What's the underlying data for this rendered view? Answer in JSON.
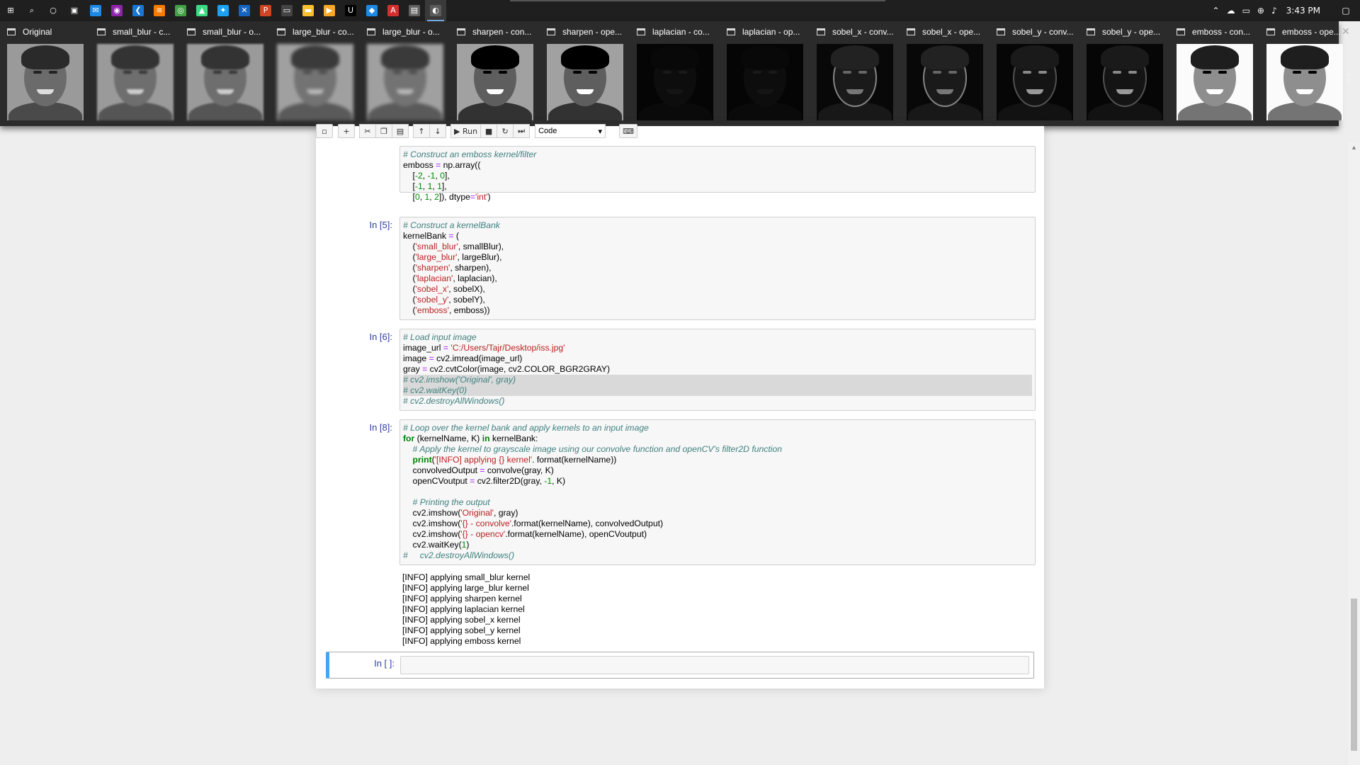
{
  "taskbar": {
    "icons": [
      {
        "name": "start-icon",
        "glyph": "⊞",
        "color": "#1f1f1f"
      },
      {
        "name": "search-icon",
        "glyph": "⌕",
        "color": "#1f1f1f"
      },
      {
        "name": "cortana-icon",
        "glyph": "○",
        "color": "#1f1f1f"
      },
      {
        "name": "store-icon",
        "glyph": "▣",
        "color": "#1f1f1f"
      },
      {
        "name": "mail-icon",
        "glyph": "✉",
        "color": "#1e88e5"
      },
      {
        "name": "media-icon",
        "glyph": "◉",
        "color": "#8e24aa"
      },
      {
        "name": "vscode-icon",
        "glyph": "❮",
        "color": "#1976d2"
      },
      {
        "name": "jupyter-icon",
        "glyph": "≋",
        "color": "#f57c00"
      },
      {
        "name": "chrome-icon",
        "glyph": "◎",
        "color": "#43a047"
      },
      {
        "name": "android-studio-icon",
        "glyph": "▲",
        "color": "#3ddc84"
      },
      {
        "name": "twitter-icon",
        "glyph": "✦",
        "color": "#1da1f2"
      },
      {
        "name": "xampp-icon",
        "glyph": "✕",
        "color": "#1565c0"
      },
      {
        "name": "powerpoint-icon",
        "glyph": "P",
        "color": "#d04423"
      },
      {
        "name": "terminal-icon",
        "glyph": "▭",
        "color": "#444444"
      },
      {
        "name": "file-explorer-icon",
        "glyph": "▬",
        "color": "#fbc02d"
      },
      {
        "name": "video-icon",
        "glyph": "▶",
        "color": "#f9a825"
      },
      {
        "name": "ide-icon",
        "glyph": "U",
        "color": "#000000"
      },
      {
        "name": "defender-icon",
        "glyph": "◆",
        "color": "#1e88e5"
      },
      {
        "name": "acrobat-icon",
        "glyph": "A",
        "color": "#d32f2f"
      },
      {
        "name": "window-icon",
        "glyph": "▤",
        "color": "#616161"
      },
      {
        "name": "python-window-icon",
        "glyph": "◐",
        "color": "#5a5a5a",
        "active": true
      }
    ],
    "tray": {
      "chevron": "^",
      "clock": "3:43 PM"
    }
  },
  "thumbnails": [
    {
      "title": "Original",
      "style": "normal"
    },
    {
      "title": "small_blur - c...",
      "style": "blur1"
    },
    {
      "title": "small_blur - o...",
      "style": "blur1"
    },
    {
      "title": "large_blur - co...",
      "style": "blur2"
    },
    {
      "title": "large_blur - o...",
      "style": "blur2"
    },
    {
      "title": "sharpen - con...",
      "style": "sharp"
    },
    {
      "title": "sharpen - ope...",
      "style": "sharp"
    },
    {
      "title": "laplacian - co...",
      "style": "dark"
    },
    {
      "title": "laplacian - op...",
      "style": "dark"
    },
    {
      "title": "sobel_x - conv...",
      "style": "edge"
    },
    {
      "title": "sobel_x - ope...",
      "style": "edge"
    },
    {
      "title": "sobel_y - conv...",
      "style": "edge2"
    },
    {
      "title": "sobel_y - ope...",
      "style": "edge2"
    },
    {
      "title": "emboss - con...",
      "style": "emboss"
    },
    {
      "title": "emboss - ope...",
      "style": "emboss"
    }
  ],
  "toolbar": {
    "run_label": "Run",
    "cell_type": "Code"
  },
  "cells": {
    "cell4": {
      "lines": [
        [
          {
            "t": "# Construct an emboss kernel/filter",
            "c": "cm"
          }
        ],
        [
          {
            "t": "emboss "
          },
          {
            "t": "=",
            "c": "op"
          },
          {
            "t": " np.array(("
          }
        ],
        [
          {
            "t": "    ["
          },
          {
            "t": "-2",
            "c": "num"
          },
          {
            "t": ", "
          },
          {
            "t": "-1",
            "c": "num"
          },
          {
            "t": ", "
          },
          {
            "t": "0",
            "c": "num"
          },
          {
            "t": "],"
          }
        ],
        [
          {
            "t": "    ["
          },
          {
            "t": "-1",
            "c": "num"
          },
          {
            "t": ", "
          },
          {
            "t": "1",
            "c": "num"
          },
          {
            "t": ", "
          },
          {
            "t": "1",
            "c": "num"
          },
          {
            "t": "],"
          }
        ],
        [
          {
            "t": "    ["
          },
          {
            "t": "0",
            "c": "num"
          },
          {
            "t": ", "
          },
          {
            "t": "1",
            "c": "num"
          },
          {
            "t": ", "
          },
          {
            "t": "2",
            "c": "num"
          },
          {
            "t": "]), dtype"
          },
          {
            "t": "=",
            "c": "op"
          },
          {
            "t": "'int'",
            "c": "str"
          },
          {
            "t": ")"
          }
        ]
      ]
    },
    "cell5": {
      "prompt": "In [5]:",
      "lines": [
        [
          {
            "t": "# Construct a kernelBank",
            "c": "cm"
          }
        ],
        [
          {
            "t": "kernelBank "
          },
          {
            "t": "=",
            "c": "op"
          },
          {
            "t": " ("
          }
        ],
        [
          {
            "t": "    ("
          },
          {
            "t": "'small_blur'",
            "c": "str"
          },
          {
            "t": ", smallBlur),"
          }
        ],
        [
          {
            "t": "    ("
          },
          {
            "t": "'large_blur'",
            "c": "str"
          },
          {
            "t": ", largeBlur),"
          }
        ],
        [
          {
            "t": "    ("
          },
          {
            "t": "'sharpen'",
            "c": "str"
          },
          {
            "t": ", sharpen),"
          }
        ],
        [
          {
            "t": "    ("
          },
          {
            "t": "'laplacian'",
            "c": "str"
          },
          {
            "t": ", laplacian),"
          }
        ],
        [
          {
            "t": "    ("
          },
          {
            "t": "'sobel_x'",
            "c": "str"
          },
          {
            "t": ", sobelX),"
          }
        ],
        [
          {
            "t": "    ("
          },
          {
            "t": "'sobel_y'",
            "c": "str"
          },
          {
            "t": ", sobelY),"
          }
        ],
        [
          {
            "t": "    ("
          },
          {
            "t": "'emboss'",
            "c": "str"
          },
          {
            "t": ", emboss))"
          }
        ]
      ]
    },
    "cell6": {
      "prompt": "In [6]:",
      "lines": [
        [
          {
            "t": "# Load input image",
            "c": "cm"
          }
        ],
        [
          {
            "t": "image_url "
          },
          {
            "t": "=",
            "c": "op"
          },
          {
            "t": " "
          },
          {
            "t": "'C:/Users/Tajr/Desktop/iss.jpg'",
            "c": "str"
          }
        ],
        [
          {
            "t": "image "
          },
          {
            "t": "=",
            "c": "op"
          },
          {
            "t": " cv2.imread(image_url)"
          }
        ],
        [
          {
            "t": "gray "
          },
          {
            "t": "=",
            "c": "op"
          },
          {
            "t": " cv2.cvtColor(image, cv2.COLOR_BGR2GRAY)"
          }
        ],
        [
          {
            "t": "# cv2.imshow('Original', gray)",
            "c": "cm",
            "hl": true
          }
        ],
        [
          {
            "t": "# cv2.waitKey(0)",
            "c": "cm",
            "hl": true
          }
        ],
        [
          {
            "t": "# cv2.destroyAllWindows()",
            "c": "cm"
          }
        ]
      ]
    },
    "cell8": {
      "prompt": "In [8]:",
      "lines": [
        [
          {
            "t": "# Loop over the kernel bank and apply kernels to an input image",
            "c": "cm"
          }
        ],
        [
          {
            "t": "for",
            "c": "kw"
          },
          {
            "t": " (kernelName, K) "
          },
          {
            "t": "in",
            "c": "kw"
          },
          {
            "t": " kernelBank:"
          }
        ],
        [
          {
            "t": "    "
          },
          {
            "t": "# Apply the kernel to grayscale image using our convolve function and openCV's filter2D function",
            "c": "cm"
          }
        ],
        [
          {
            "t": "    "
          },
          {
            "t": "print",
            "c": "kw"
          },
          {
            "t": "("
          },
          {
            "t": "'[INFO] applying {} kernel'",
            "c": "str"
          },
          {
            "t": ". format(kernelName))"
          }
        ],
        [
          {
            "t": "    convolvedOutput "
          },
          {
            "t": "=",
            "c": "op"
          },
          {
            "t": " convolve(gray, K)"
          }
        ],
        [
          {
            "t": "    openCVoutput "
          },
          {
            "t": "=",
            "c": "op"
          },
          {
            "t": " cv2.filter2D(gray, "
          },
          {
            "t": "-1",
            "c": "num"
          },
          {
            "t": ", K)"
          }
        ],
        [
          {
            "t": ""
          }
        ],
        [
          {
            "t": "    "
          },
          {
            "t": "# Printing the output",
            "c": "cm"
          }
        ],
        [
          {
            "t": "    cv2.imshow("
          },
          {
            "t": "'Original'",
            "c": "str"
          },
          {
            "t": ", gray)"
          }
        ],
        [
          {
            "t": "    cv2.imshow("
          },
          {
            "t": "'{} - convolve'",
            "c": "str"
          },
          {
            "t": ".format(kernelName), convolvedOutput)"
          }
        ],
        [
          {
            "t": "    cv2.imshow("
          },
          {
            "t": "'{} - opencv'",
            "c": "str"
          },
          {
            "t": ".format(kernelName), openCVoutput)"
          }
        ],
        [
          {
            "t": "    cv2.waitKey("
          },
          {
            "t": "1",
            "c": "num"
          },
          {
            "t": ")"
          }
        ],
        [
          {
            "t": "#     cv2.destroyAllWindows()",
            "c": "cm"
          }
        ]
      ],
      "output": [
        "[INFO] applying small_blur kernel",
        "[INFO] applying large_blur kernel",
        "[INFO] applying sharpen kernel",
        "[INFO] applying laplacian kernel",
        "[INFO] applying sobel_x kernel",
        "[INFO] applying sobel_y kernel",
        "[INFO] applying emboss kernel"
      ]
    },
    "empty": {
      "prompt": "In [ ]:"
    }
  },
  "colors": {
    "prompt": "#303f9f",
    "active_cell": "#42a5f5"
  }
}
